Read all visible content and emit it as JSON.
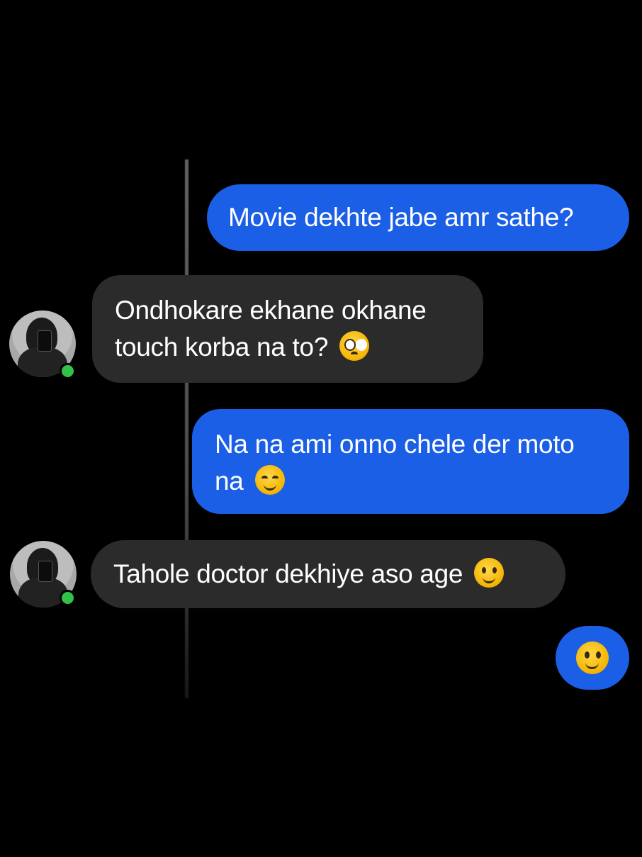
{
  "messages": [
    {
      "side": "sent",
      "text": "Movie dekhte jabe amr sathe?"
    },
    {
      "side": "received",
      "line1": "Ondhokare ekhane okhane",
      "line2": "touch korba na to?",
      "emoji": "pleading-face"
    },
    {
      "side": "sent",
      "line1": "Na na ami onno chele der moto",
      "line2": "na",
      "emoji": "smiling-blush-face"
    },
    {
      "side": "received",
      "text": "Tahole doctor dekhiye aso age",
      "emoji": "slightly-smiling-face"
    },
    {
      "side": "sent",
      "emoji": "slightly-smiling-face"
    }
  ],
  "colors": {
    "background": "#000000",
    "sent_bubble": "#1a5fe6",
    "received_bubble": "#2b2b2b",
    "online_dot": "#31c24a"
  },
  "contact": {
    "status": "online"
  }
}
